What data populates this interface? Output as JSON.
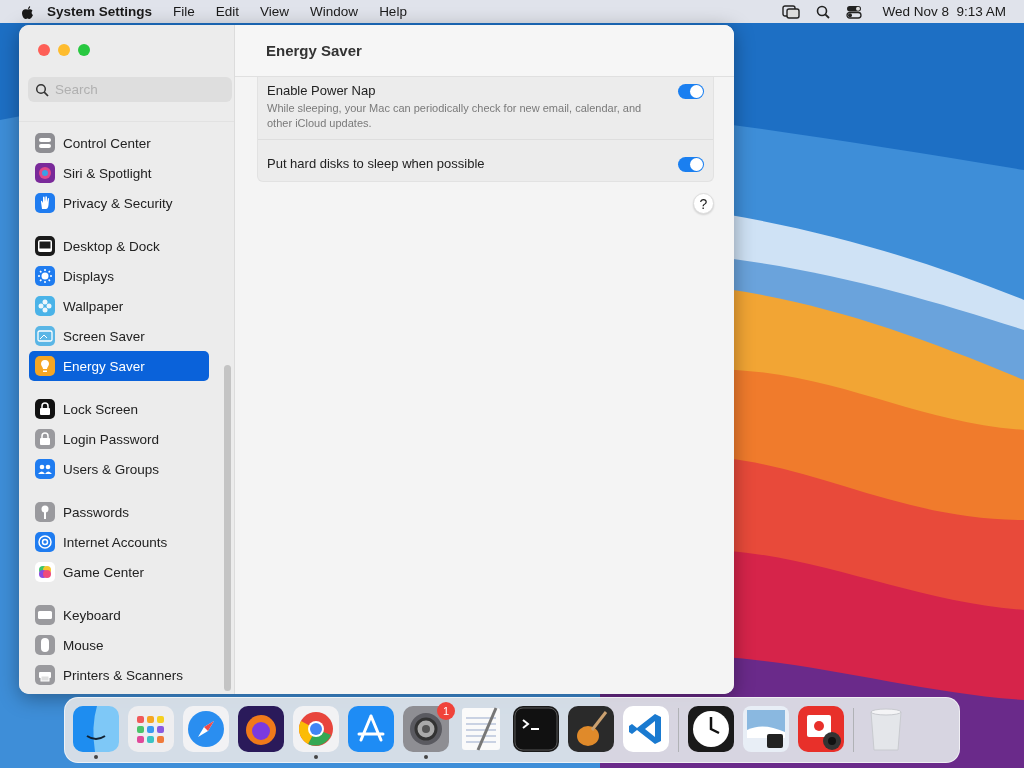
{
  "menu_bar": {
    "app_name": "System Settings",
    "menus": [
      "File",
      "Edit",
      "View",
      "Window",
      "Help"
    ],
    "clock": "Wed Nov 8  9:13 AM"
  },
  "window": {
    "title": "Energy Saver",
    "search": {
      "placeholder": "Search"
    },
    "sidebar": {
      "groups": [
        {
          "items": [
            {
              "label": "Control Center",
              "selected": false
            },
            {
              "label": "Siri & Spotlight",
              "selected": false
            },
            {
              "label": "Privacy & Security",
              "selected": false
            }
          ]
        },
        {
          "items": [
            {
              "label": "Desktop & Dock",
              "selected": false
            },
            {
              "label": "Displays",
              "selected": false
            },
            {
              "label": "Wallpaper",
              "selected": false
            },
            {
              "label": "Screen Saver",
              "selected": false
            },
            {
              "label": "Energy Saver",
              "selected": true
            }
          ]
        },
        {
          "items": [
            {
              "label": "Lock Screen",
              "selected": false
            },
            {
              "label": "Login Password",
              "selected": false
            },
            {
              "label": "Users & Groups",
              "selected": false
            }
          ]
        },
        {
          "items": [
            {
              "label": "Passwords",
              "selected": false
            },
            {
              "label": "Internet Accounts",
              "selected": false
            },
            {
              "label": "Game Center",
              "selected": false
            }
          ]
        },
        {
          "items": [
            {
              "label": "Keyboard",
              "selected": false
            },
            {
              "label": "Mouse",
              "selected": false
            },
            {
              "label": "Printers & Scanners",
              "selected": false
            }
          ]
        }
      ]
    },
    "settings": [
      {
        "title": "Enable Power Nap",
        "description": "While sleeping, your Mac can periodically check for new email, calendar, and other iCloud updates.",
        "on": true
      },
      {
        "title": "Put hard disks to sleep when possible",
        "on": true
      }
    ],
    "help_button": "?"
  },
  "dock": {
    "groups": [
      {
        "items": [
          {
            "running": true
          },
          {
            "running": false
          },
          {
            "running": false
          },
          {
            "running": false
          },
          {
            "running": true
          },
          {
            "running": false
          },
          {
            "running": true,
            "badge": "1"
          },
          {
            "running": false
          },
          {
            "running": false
          },
          {
            "running": false
          },
          {
            "running": false
          }
        ]
      },
      {
        "items": [
          {
            "running": false
          },
          {
            "running": false
          },
          {
            "running": false
          }
        ]
      },
      {
        "items": [
          {
            "running": false
          }
        ]
      }
    ]
  }
}
